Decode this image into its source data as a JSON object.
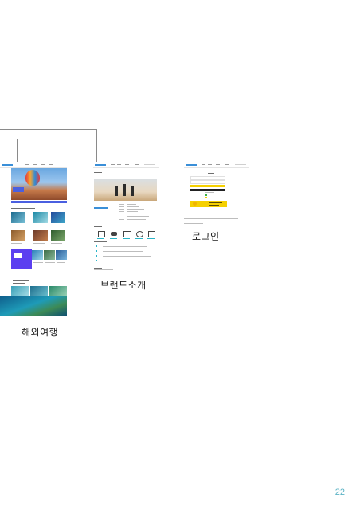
{
  "screens": [
    {
      "id": "overseas",
      "caption": "해외여행"
    },
    {
      "id": "brand",
      "caption": "브랜드소개"
    },
    {
      "id": "login",
      "caption": "로그인"
    }
  ],
  "page_number": "22",
  "colors": {
    "connector": "#8a8a8a",
    "page_number": "#5cb3c5",
    "accent_purple": "#5b3ff0",
    "accent_yellow": "#f5d000",
    "accent_teal": "#2bb5c8"
  }
}
